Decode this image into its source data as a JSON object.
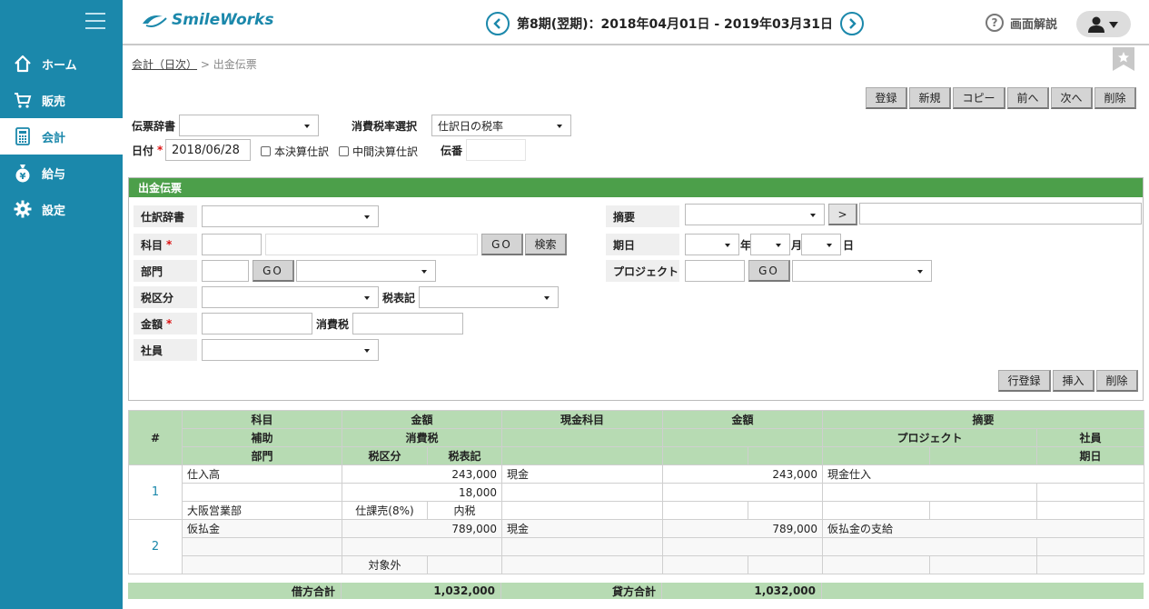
{
  "sidebar": {
    "items": [
      {
        "label": "ホーム",
        "icon": "home-icon"
      },
      {
        "label": "販売",
        "icon": "cart-icon"
      },
      {
        "label": "会計",
        "icon": "calculator-icon"
      },
      {
        "label": "給与",
        "icon": "yen-bag-icon"
      },
      {
        "label": "設定",
        "icon": "gear-icon"
      }
    ],
    "active_index": 2
  },
  "header": {
    "logo_text": "SmileWorks",
    "period": "第8期(翌期)：2018年04月01日 - 2019年03月31日",
    "help": "画面解説"
  },
  "breadcrumb": {
    "parent": "会計（日次）",
    "separator": " > ",
    "current": "出金伝票"
  },
  "toolbar": [
    "登録",
    "新規",
    "コピー",
    "前へ",
    "次へ",
    "削除"
  ],
  "form": {
    "voucher_dict_label": "伝票辞書",
    "tax_rate_label": "消費税率選択",
    "tax_rate_value": "仕訳日の税率",
    "date_label": "日付",
    "date_value": "2018/06/28",
    "check_final": "本決算仕訳",
    "check_interim": "中間決算仕訳",
    "voucher_no_label": "伝番"
  },
  "panel": {
    "title": "出金伝票",
    "journal_dict": "仕訳辞書",
    "account": "科目",
    "department": "部門",
    "tax_class": "税区分",
    "tax_notation": "税表記",
    "amount": "金額",
    "consumption_tax": "消費税",
    "employee": "社員",
    "summary": "摘要",
    "due_date": "期日",
    "year": "年",
    "month": "月",
    "day": "日",
    "project": "プロジェクト",
    "go": "GO",
    "search": "検索",
    "arrow": ">",
    "row_register": "行登録",
    "insert": "挿入",
    "delete": "削除"
  },
  "table": {
    "headers": {
      "num": "#",
      "account": "科目",
      "sub": "補助",
      "dept": "部門",
      "amount": "金額",
      "tax": "消費税",
      "tax_class": "税区分",
      "tax_notation": "税表記",
      "cash_account": "現金科目",
      "cash_amount": "金額",
      "summary": "摘要",
      "project": "プロジェクト",
      "employee": "社員",
      "due": "期日"
    },
    "rows": [
      {
        "num": "1",
        "account": "仕入高",
        "amount": "243,000",
        "cash_account": "現金",
        "cash_amount": "243,000",
        "summary": "現金仕入",
        "tax": "18,000",
        "dept": "大阪営業部",
        "tax_class": "仕課売(8%)",
        "tax_notation": "内税"
      },
      {
        "num": "2",
        "account": "仮払金",
        "amount": "789,000",
        "cash_account": "現金",
        "cash_amount": "789,000",
        "summary": "仮払金の支給",
        "tax": "",
        "dept": "",
        "tax_class": "対象外",
        "tax_notation": ""
      }
    ]
  },
  "totals": {
    "debit_label": "借方合計",
    "debit_value": "1,032,000",
    "credit_label": "貸方合計",
    "credit_value": "1,032,000"
  }
}
